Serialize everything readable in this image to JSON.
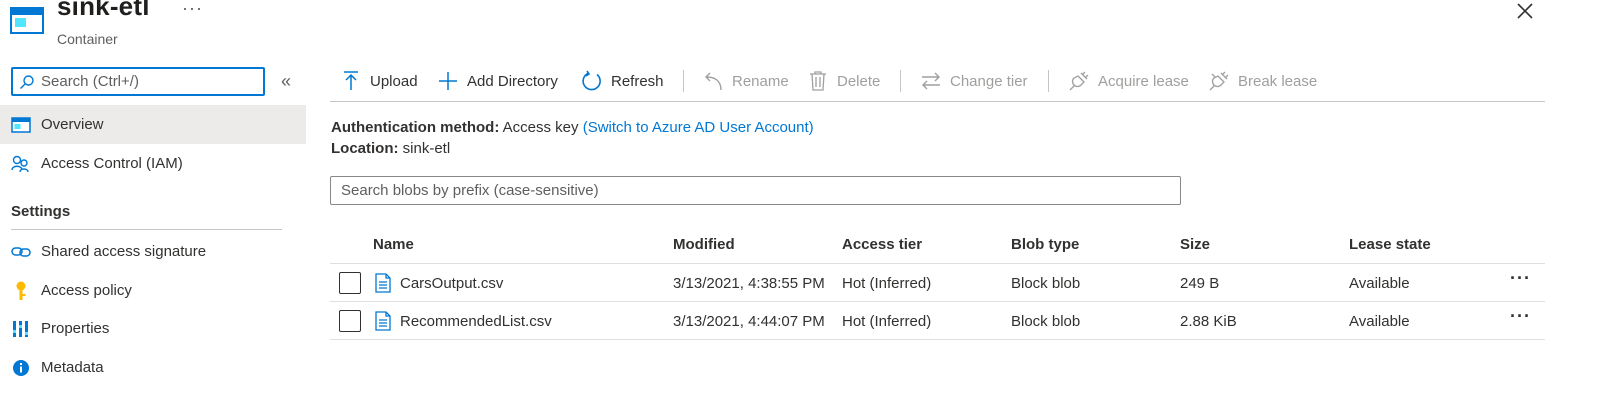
{
  "header": {
    "title": "sink-etl",
    "subtitle": "Container",
    "more_label": "···",
    "close_icon": "close-icon"
  },
  "nav": {
    "search_placeholder": "Search (Ctrl+/)",
    "collapse_label": "«",
    "items": [
      {
        "label": "Overview",
        "icon": "container-icon",
        "active": true
      },
      {
        "label": "Access Control (IAM)",
        "icon": "people-icon"
      }
    ],
    "section_title": "Settings",
    "settings_items": [
      {
        "label": "Shared access signature",
        "icon": "link-icon"
      },
      {
        "label": "Access policy",
        "icon": "key-icon"
      },
      {
        "label": "Properties",
        "icon": "properties-icon"
      },
      {
        "label": "Metadata",
        "icon": "info-icon"
      }
    ]
  },
  "toolbar": {
    "upload": "Upload",
    "add_directory": "Add Directory",
    "refresh": "Refresh",
    "rename": "Rename",
    "delete": "Delete",
    "change_tier": "Change tier",
    "acquire_lease": "Acquire lease",
    "break_lease": "Break lease"
  },
  "info": {
    "auth_label": "Authentication method:",
    "auth_value": "Access key",
    "auth_link": "(Switch to Azure AD User Account)",
    "location_label": "Location:",
    "location_value": "sink-etl"
  },
  "blob_search": {
    "placeholder": "Search blobs by prefix (case-sensitive)"
  },
  "table": {
    "columns": [
      "Name",
      "Modified",
      "Access tier",
      "Blob type",
      "Size",
      "Lease state"
    ],
    "rows": [
      {
        "name": "CarsOutput.csv",
        "modified": "3/13/2021, 4:38:55 PM",
        "tier": "Hot (Inferred)",
        "type": "Block blob",
        "size": "249 B",
        "lease": "Available"
      },
      {
        "name": "RecommendedList.csv",
        "modified": "3/13/2021, 4:44:07 PM",
        "tier": "Hot (Inferred)",
        "type": "Block blob",
        "size": "2.88 KiB",
        "lease": "Available"
      }
    ],
    "row_more": "···"
  },
  "colors": {
    "accent": "#0078d4",
    "text": "#323130",
    "disabled": "#a19f9d",
    "active_bg": "#edebe9"
  }
}
